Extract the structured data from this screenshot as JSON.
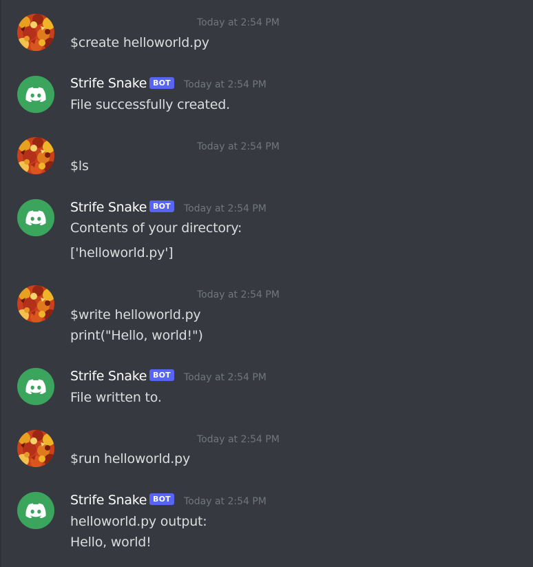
{
  "bot": {
    "name": "Strife Snake",
    "tag": "BOT"
  },
  "messages": [
    {
      "author": "user",
      "timestamp": "Today at 2:54 PM",
      "lines": [
        "$create helloworld.py"
      ]
    },
    {
      "author": "bot",
      "timestamp": "Today at 2:54 PM",
      "lines": [
        "File successfully created."
      ]
    },
    {
      "author": "user",
      "timestamp": "Today at 2:54 PM",
      "lines": [
        "$ls"
      ]
    },
    {
      "author": "bot",
      "timestamp": "Today at 2:54 PM",
      "lines": [
        "Contents of your directory:",
        "['helloworld.py']"
      ]
    },
    {
      "author": "user",
      "timestamp": "Today at 2:54 PM",
      "lines": [
        "$write helloworld.py",
        "print(\"Hello, world!\")"
      ]
    },
    {
      "author": "bot",
      "timestamp": "Today at 2:54 PM",
      "lines": [
        "File written to."
      ]
    },
    {
      "author": "user",
      "timestamp": "Today at 2:54 PM",
      "lines": [
        "$run helloworld.py"
      ]
    },
    {
      "author": "bot",
      "timestamp": "Today at 2:54 PM",
      "lines": [
        "helloworld.py output:",
        "Hello, world!"
      ]
    }
  ],
  "colors": {
    "background": "#36393f",
    "bot_avatar": "#3ba55d",
    "bot_tag": "#5865f2",
    "username": "#ffffff",
    "message_text": "#dcddde",
    "timestamp": "#72767d"
  },
  "icons": {
    "user_avatar": "autumn-leaves-avatar",
    "bot_avatar": "discord-logo-icon"
  }
}
